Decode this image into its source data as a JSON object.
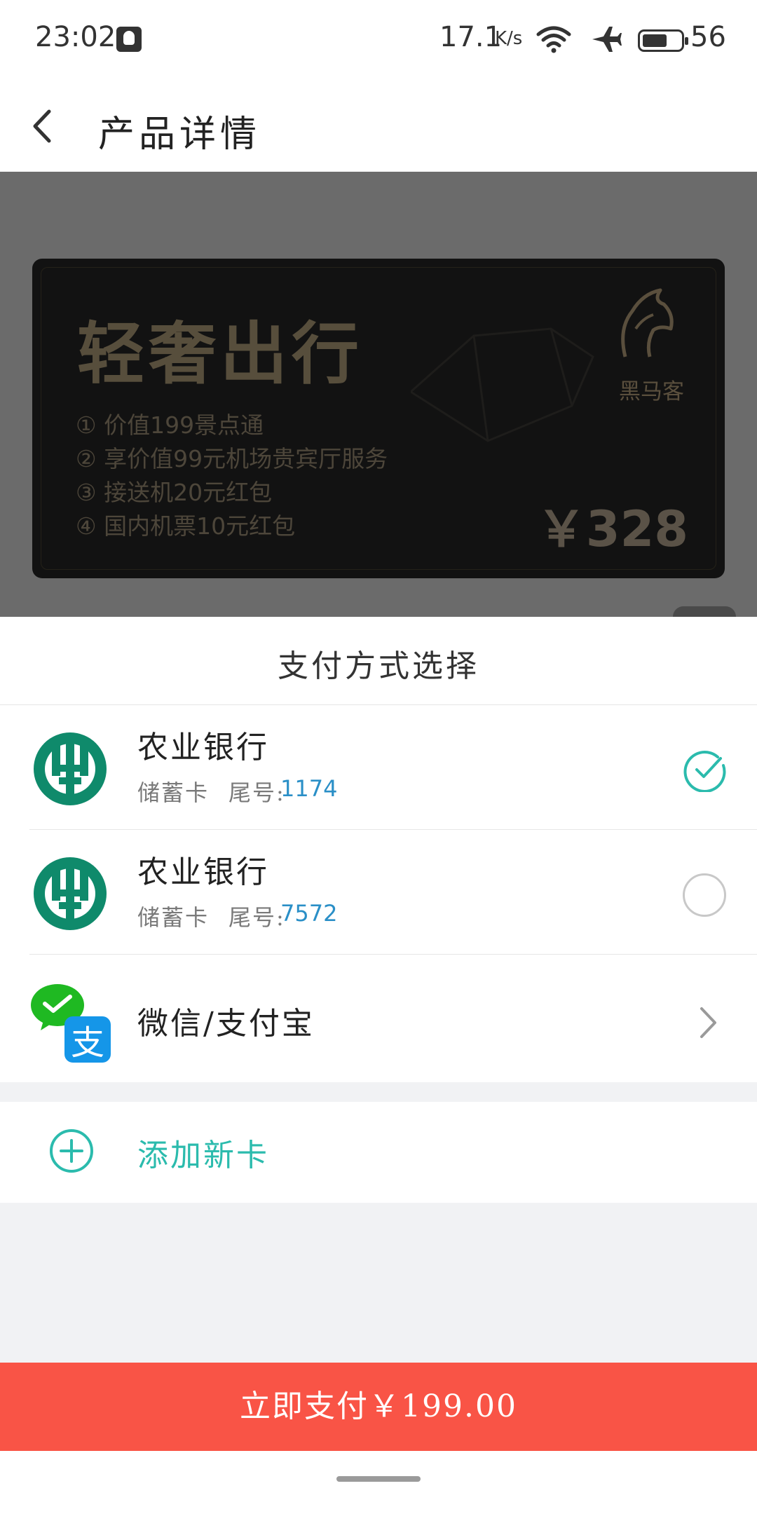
{
  "status_bar": {
    "time": "23:02",
    "net_speed": "17.1",
    "net_speed_unit": "K/s",
    "battery": "56",
    "icons": [
      "qq-icon",
      "wifi-icon",
      "airplane-icon",
      "battery-icon"
    ]
  },
  "header": {
    "back_icon": "back-arrow-icon",
    "title": "产品详情"
  },
  "product_card": {
    "title": "轻奢出行",
    "benefits": [
      "① 价值199景点通",
      "② 享价值99元机场贵宾厅服务",
      "③ 接送机20元红包",
      "④ 国内机票10元红包"
    ],
    "brand": "黑马客",
    "price": "￥328"
  },
  "payment_sheet": {
    "title": "支付方式选择",
    "methods": [
      {
        "bank": "农业银行",
        "card_type": "储蓄卡",
        "tail_label": "尾号:",
        "tail_number": "1174",
        "selected": true
      },
      {
        "bank": "农业银行",
        "card_type": "储蓄卡",
        "tail_label": "尾号:",
        "tail_number": "7572",
        "selected": false
      }
    ],
    "wallet_label": "微信/支付宝",
    "add_card_label": "添加新卡",
    "pay_button_label": "立即支付￥199.00"
  },
  "colors": {
    "accent_teal": "#2bbbad",
    "pay_button": "#f95446",
    "abc_green": "#0f8a6b",
    "link_blue": "#2a8fc7"
  }
}
